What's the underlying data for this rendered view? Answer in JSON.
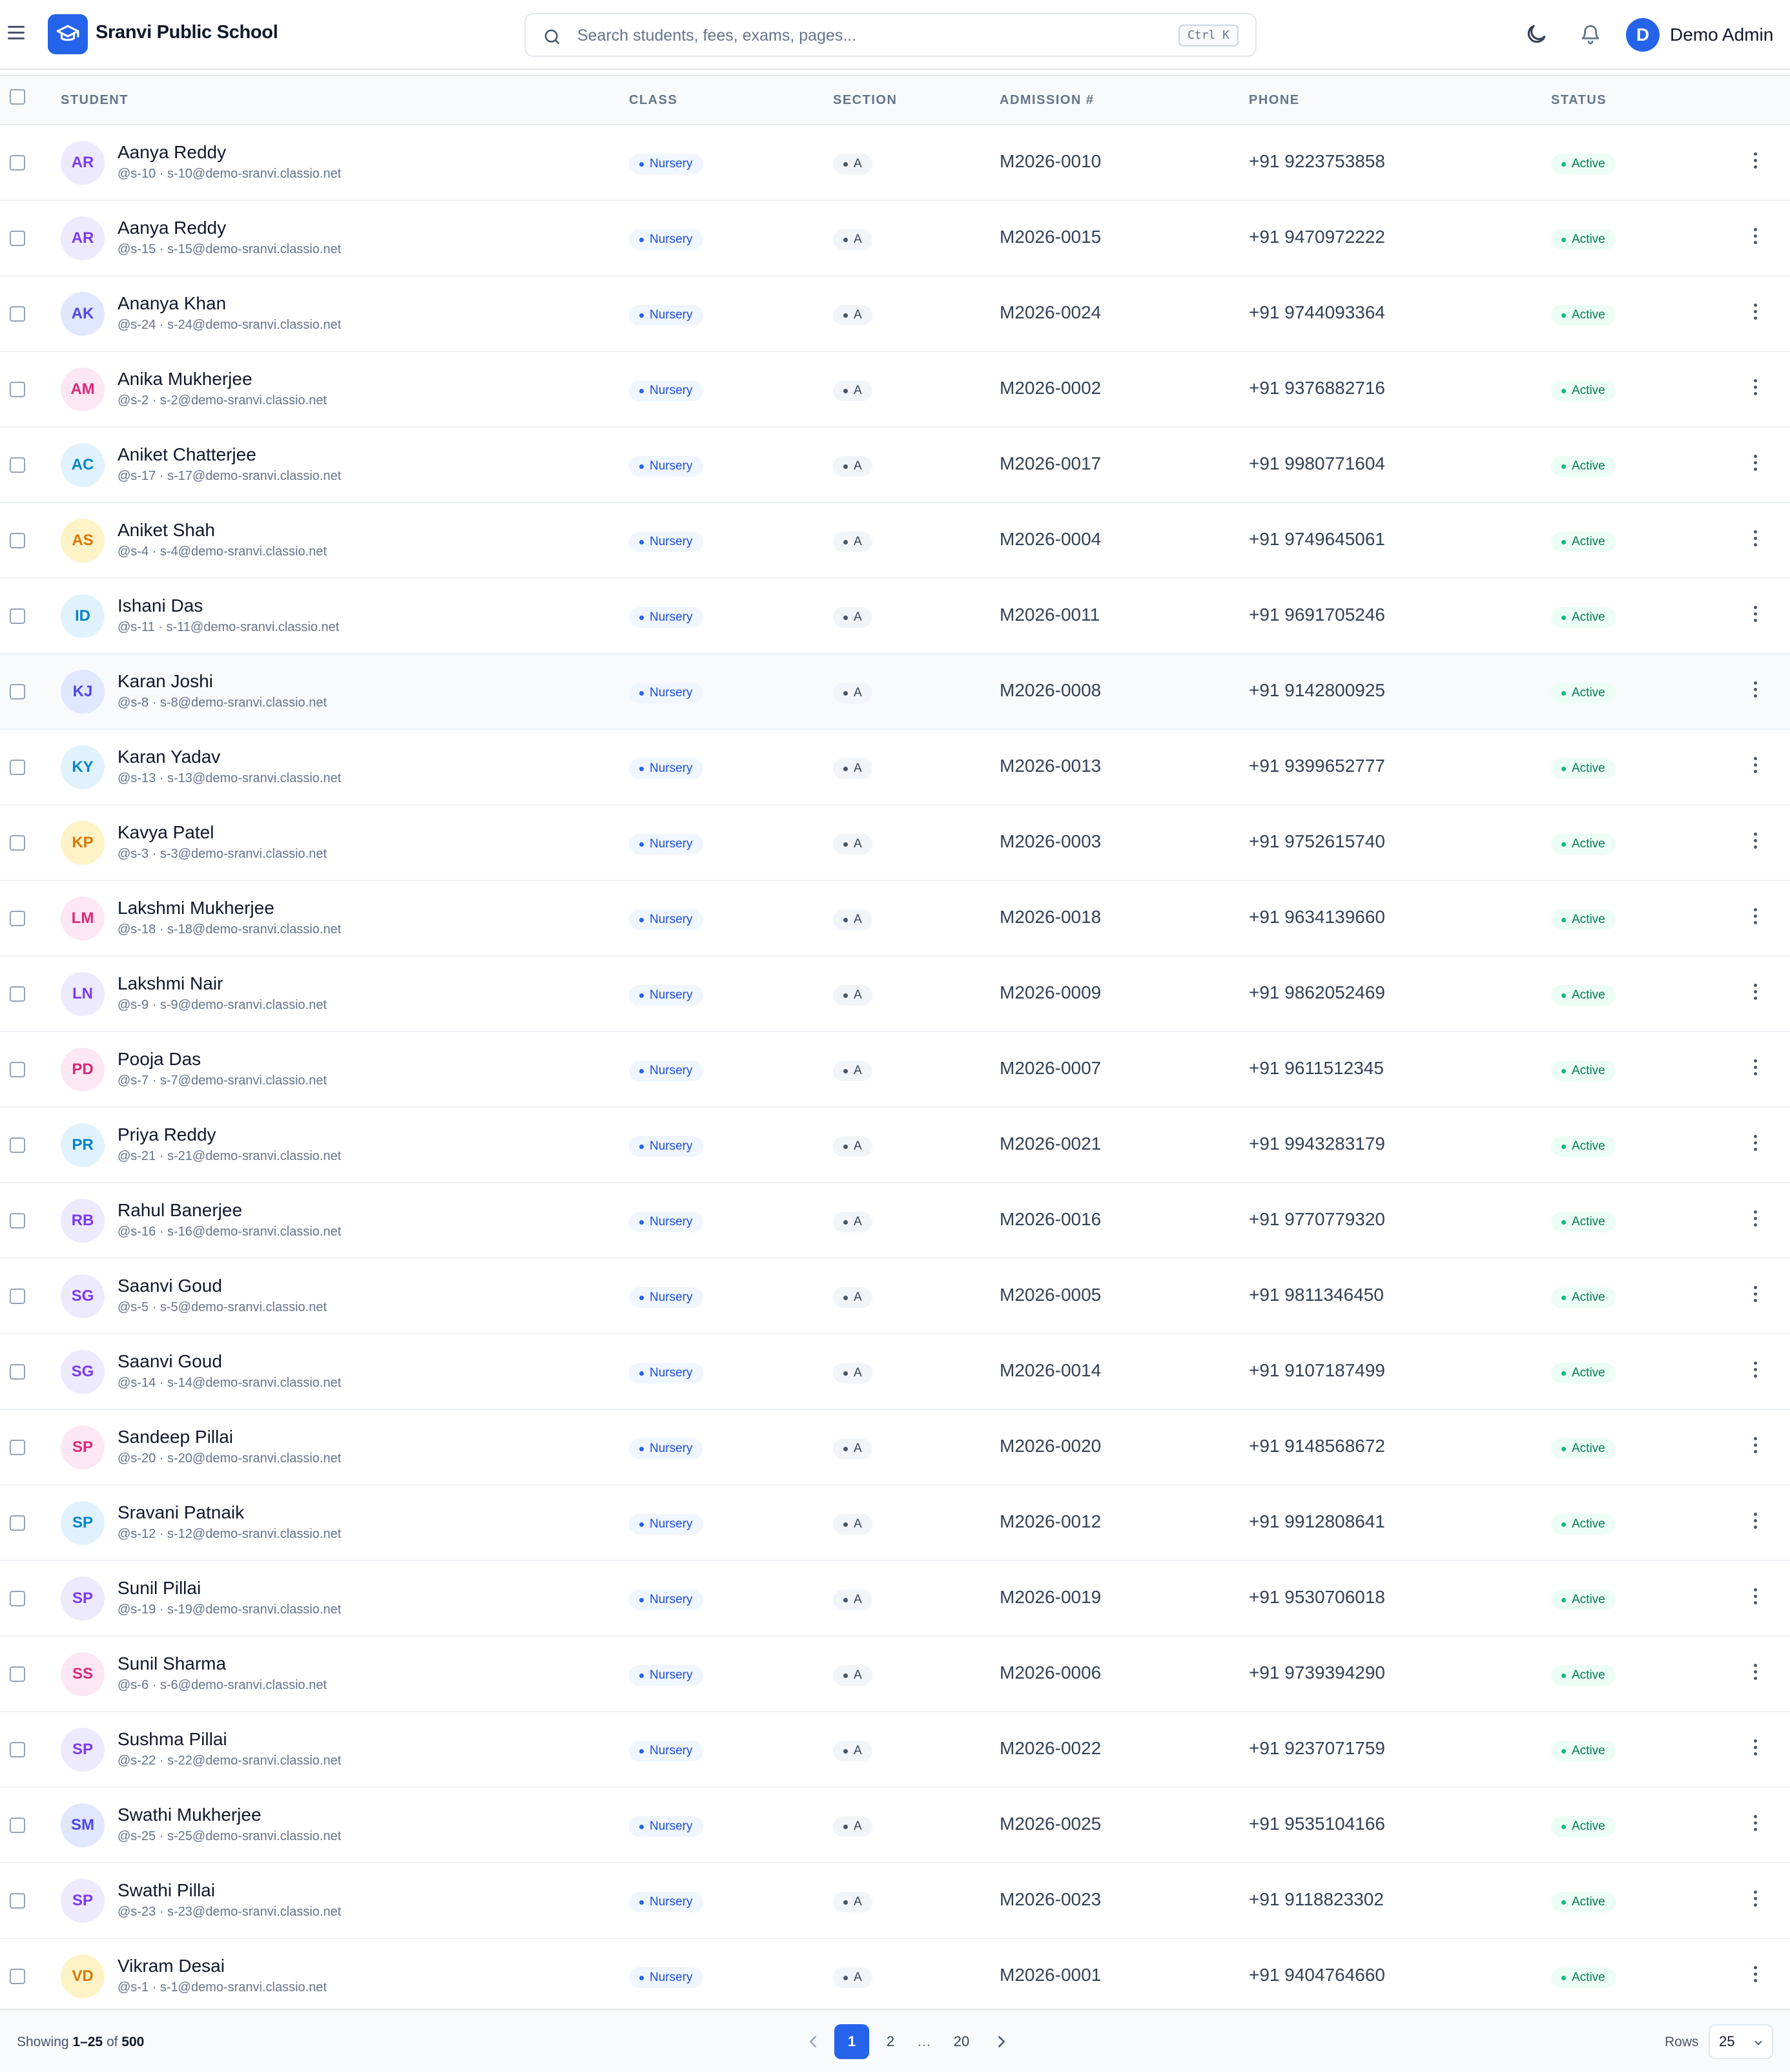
{
  "header": {
    "app_name": "Sranvi Public School",
    "search_placeholder": "Search students, fees, exams, pages...",
    "shortcut": "Ctrl K",
    "avatar_initial": "D",
    "user_name": "Demo Admin",
    "icons": [
      "menu-icon",
      "graduation-cap-icon",
      "search-icon",
      "moon-icon",
      "bell-icon"
    ]
  },
  "table": {
    "columns": {
      "student": "STUDENT",
      "class": "CLASS",
      "section": "SECTION",
      "admission": "ADMISSION #",
      "phone": "PHONE",
      "status": "STATUS"
    },
    "rows": [
      {
        "initials": "AR",
        "name": "Aanya Reddy",
        "sub": "@s-10 · s-10@demo-sranvi.classio.net",
        "class": "Nursery",
        "section": "A",
        "admission": "M2026-0010",
        "phone": "+91 9223753858",
        "status": "Active",
        "color": "purple"
      },
      {
        "initials": "AR",
        "name": "Aanya Reddy",
        "sub": "@s-15 · s-15@demo-sranvi.classio.net",
        "class": "Nursery",
        "section": "A",
        "admission": "M2026-0015",
        "phone": "+91 9470972222",
        "status": "Active",
        "color": "purple"
      },
      {
        "initials": "AK",
        "name": "Ananya Khan",
        "sub": "@s-24 · s-24@demo-sranvi.classio.net",
        "class": "Nursery",
        "section": "A",
        "admission": "M2026-0024",
        "phone": "+91 9744093364",
        "status": "Active",
        "color": "indigo"
      },
      {
        "initials": "AM",
        "name": "Anika Mukherjee",
        "sub": "@s-2 · s-2@demo-sranvi.classio.net",
        "class": "Nursery",
        "section": "A",
        "admission": "M2026-0002",
        "phone": "+91 9376882716",
        "status": "Active",
        "color": "pink"
      },
      {
        "initials": "AC",
        "name": "Aniket Chatterjee",
        "sub": "@s-17 · s-17@demo-sranvi.classio.net",
        "class": "Nursery",
        "section": "A",
        "admission": "M2026-0017",
        "phone": "+91 9980771604",
        "status": "Active",
        "color": "sky"
      },
      {
        "initials": "AS",
        "name": "Aniket Shah",
        "sub": "@s-4 · s-4@demo-sranvi.classio.net",
        "class": "Nursery",
        "section": "A",
        "admission": "M2026-0004",
        "phone": "+91 9749645061",
        "status": "Active",
        "color": "amber"
      },
      {
        "initials": "ID",
        "name": "Ishani Das",
        "sub": "@s-11 · s-11@demo-sranvi.classio.net",
        "class": "Nursery",
        "section": "A",
        "admission": "M2026-0011",
        "phone": "+91 9691705246",
        "status": "Active",
        "color": "sky"
      },
      {
        "initials": "KJ",
        "name": "Karan Joshi",
        "sub": "@s-8 · s-8@demo-sranvi.classio.net",
        "class": "Nursery",
        "section": "A",
        "admission": "M2026-0008",
        "phone": "+91 9142800925",
        "status": "Active",
        "color": "indigo"
      },
      {
        "initials": "KY",
        "name": "Karan Yadav",
        "sub": "@s-13 · s-13@demo-sranvi.classio.net",
        "class": "Nursery",
        "section": "A",
        "admission": "M2026-0013",
        "phone": "+91 9399652777",
        "status": "Active",
        "color": "sky"
      },
      {
        "initials": "KP",
        "name": "Kavya Patel",
        "sub": "@s-3 · s-3@demo-sranvi.classio.net",
        "class": "Nursery",
        "section": "A",
        "admission": "M2026-0003",
        "phone": "+91 9752615740",
        "status": "Active",
        "color": "amber"
      },
      {
        "initials": "LM",
        "name": "Lakshmi Mukherjee",
        "sub": "@s-18 · s-18@demo-sranvi.classio.net",
        "class": "Nursery",
        "section": "A",
        "admission": "M2026-0018",
        "phone": "+91 9634139660",
        "status": "Active",
        "color": "pink"
      },
      {
        "initials": "LN",
        "name": "Lakshmi Nair",
        "sub": "@s-9 · s-9@demo-sranvi.classio.net",
        "class": "Nursery",
        "section": "A",
        "admission": "M2026-0009",
        "phone": "+91 9862052469",
        "status": "Active",
        "color": "purple"
      },
      {
        "initials": "PD",
        "name": "Pooja Das",
        "sub": "@s-7 · s-7@demo-sranvi.classio.net",
        "class": "Nursery",
        "section": "A",
        "admission": "M2026-0007",
        "phone": "+91 9611512345",
        "status": "Active",
        "color": "pink"
      },
      {
        "initials": "PR",
        "name": "Priya Reddy",
        "sub": "@s-21 · s-21@demo-sranvi.classio.net",
        "class": "Nursery",
        "section": "A",
        "admission": "M2026-0021",
        "phone": "+91 9943283179",
        "status": "Active",
        "color": "sky"
      },
      {
        "initials": "RB",
        "name": "Rahul Banerjee",
        "sub": "@s-16 · s-16@demo-sranvi.classio.net",
        "class": "Nursery",
        "section": "A",
        "admission": "M2026-0016",
        "phone": "+91 9770779320",
        "status": "Active",
        "color": "purple"
      },
      {
        "initials": "SG",
        "name": "Saanvi Goud",
        "sub": "@s-5 · s-5@demo-sranvi.classio.net",
        "class": "Nursery",
        "section": "A",
        "admission": "M2026-0005",
        "phone": "+91 9811346450",
        "status": "Active",
        "color": "purple"
      },
      {
        "initials": "SG",
        "name": "Saanvi Goud",
        "sub": "@s-14 · s-14@demo-sranvi.classio.net",
        "class": "Nursery",
        "section": "A",
        "admission": "M2026-0014",
        "phone": "+91 9107187499",
        "status": "Active",
        "color": "purple"
      },
      {
        "initials": "SP",
        "name": "Sandeep Pillai",
        "sub": "@s-20 · s-20@demo-sranvi.classio.net",
        "class": "Nursery",
        "section": "A",
        "admission": "M2026-0020",
        "phone": "+91 9148568672",
        "status": "Active",
        "color": "pink"
      },
      {
        "initials": "SP",
        "name": "Sravani Patnaik",
        "sub": "@s-12 · s-12@demo-sranvi.classio.net",
        "class": "Nursery",
        "section": "A",
        "admission": "M2026-0012",
        "phone": "+91 9912808641",
        "status": "Active",
        "color": "sky"
      },
      {
        "initials": "SP",
        "name": "Sunil Pillai",
        "sub": "@s-19 · s-19@demo-sranvi.classio.net",
        "class": "Nursery",
        "section": "A",
        "admission": "M2026-0019",
        "phone": "+91 9530706018",
        "status": "Active",
        "color": "purple"
      },
      {
        "initials": "SS",
        "name": "Sunil Sharma",
        "sub": "@s-6 · s-6@demo-sranvi.classio.net",
        "class": "Nursery",
        "section": "A",
        "admission": "M2026-0006",
        "phone": "+91 9739394290",
        "status": "Active",
        "color": "pink"
      },
      {
        "initials": "SP",
        "name": "Sushma Pillai",
        "sub": "@s-22 · s-22@demo-sranvi.classio.net",
        "class": "Nursery",
        "section": "A",
        "admission": "M2026-0022",
        "phone": "+91 9237071759",
        "status": "Active",
        "color": "purple"
      },
      {
        "initials": "SM",
        "name": "Swathi Mukherjee",
        "sub": "@s-25 · s-25@demo-sranvi.classio.net",
        "class": "Nursery",
        "section": "A",
        "admission": "M2026-0025",
        "phone": "+91 9535104166",
        "status": "Active",
        "color": "indigo"
      },
      {
        "initials": "SP",
        "name": "Swathi Pillai",
        "sub": "@s-23 · s-23@demo-sranvi.classio.net",
        "class": "Nursery",
        "section": "A",
        "admission": "M2026-0023",
        "phone": "+91 9118823302",
        "status": "Active",
        "color": "purple"
      },
      {
        "initials": "VD",
        "name": "Vikram Desai",
        "sub": "@s-1 · s-1@demo-sranvi.classio.net",
        "class": "Nursery",
        "section": "A",
        "admission": "M2026-0001",
        "phone": "+91 9404764660",
        "status": "Active",
        "color": "amber"
      }
    ]
  },
  "footer": {
    "showing_prefix": "Showing ",
    "showing_range": "1–25",
    "showing_of": " of ",
    "showing_total": "500",
    "pages": [
      "1",
      "2",
      "…",
      "20"
    ],
    "current_page": "1",
    "rows_label": "Rows",
    "rows_value": "25"
  },
  "colors": {
    "accent": "#2563eb",
    "status_active": "#047857"
  }
}
